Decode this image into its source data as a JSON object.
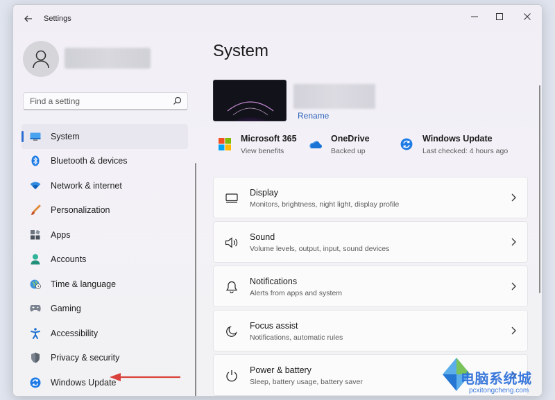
{
  "window": {
    "title": "Settings"
  },
  "search": {
    "placeholder": "Find a setting"
  },
  "sidebar": {
    "items": [
      {
        "label": "System",
        "icon": "system-icon"
      },
      {
        "label": "Bluetooth & devices",
        "icon": "bluetooth-icon"
      },
      {
        "label": "Network & internet",
        "icon": "network-icon"
      },
      {
        "label": "Personalization",
        "icon": "personalization-icon"
      },
      {
        "label": "Apps",
        "icon": "apps-icon"
      },
      {
        "label": "Accounts",
        "icon": "accounts-icon"
      },
      {
        "label": "Time & language",
        "icon": "time-language-icon"
      },
      {
        "label": "Gaming",
        "icon": "gaming-icon"
      },
      {
        "label": "Accessibility",
        "icon": "accessibility-icon"
      },
      {
        "label": "Privacy & security",
        "icon": "privacy-icon"
      },
      {
        "label": "Windows Update",
        "icon": "windows-update-icon"
      }
    ],
    "active_index": 0
  },
  "main": {
    "title": "System",
    "rename_label": "Rename",
    "quick_actions": [
      {
        "title": "Microsoft 365",
        "subtitle": "View benefits",
        "icon": "microsoft-365-icon"
      },
      {
        "title": "OneDrive",
        "subtitle": "Backed up",
        "icon": "onedrive-icon"
      },
      {
        "title": "Windows Update",
        "subtitle": "Last checked: 4 hours ago",
        "icon": "windows-update-icon"
      }
    ],
    "cards": [
      {
        "title": "Display",
        "subtitle": "Monitors, brightness, night light, display profile",
        "icon": "display-icon"
      },
      {
        "title": "Sound",
        "subtitle": "Volume levels, output, input, sound devices",
        "icon": "sound-icon"
      },
      {
        "title": "Notifications",
        "subtitle": "Alerts from apps and system",
        "icon": "notifications-icon"
      },
      {
        "title": "Focus assist",
        "subtitle": "Notifications, automatic rules",
        "icon": "focus-assist-icon"
      },
      {
        "title": "Power & battery",
        "subtitle": "Sleep, battery usage, battery saver",
        "icon": "power-icon"
      }
    ]
  },
  "watermark": {
    "text": "电脑系统城",
    "url": "pcxitongcheng.com"
  },
  "colors": {
    "accent": "#2b6cd2",
    "annotation_arrow": "#d9413b",
    "watermark": "#2c6fd8"
  }
}
